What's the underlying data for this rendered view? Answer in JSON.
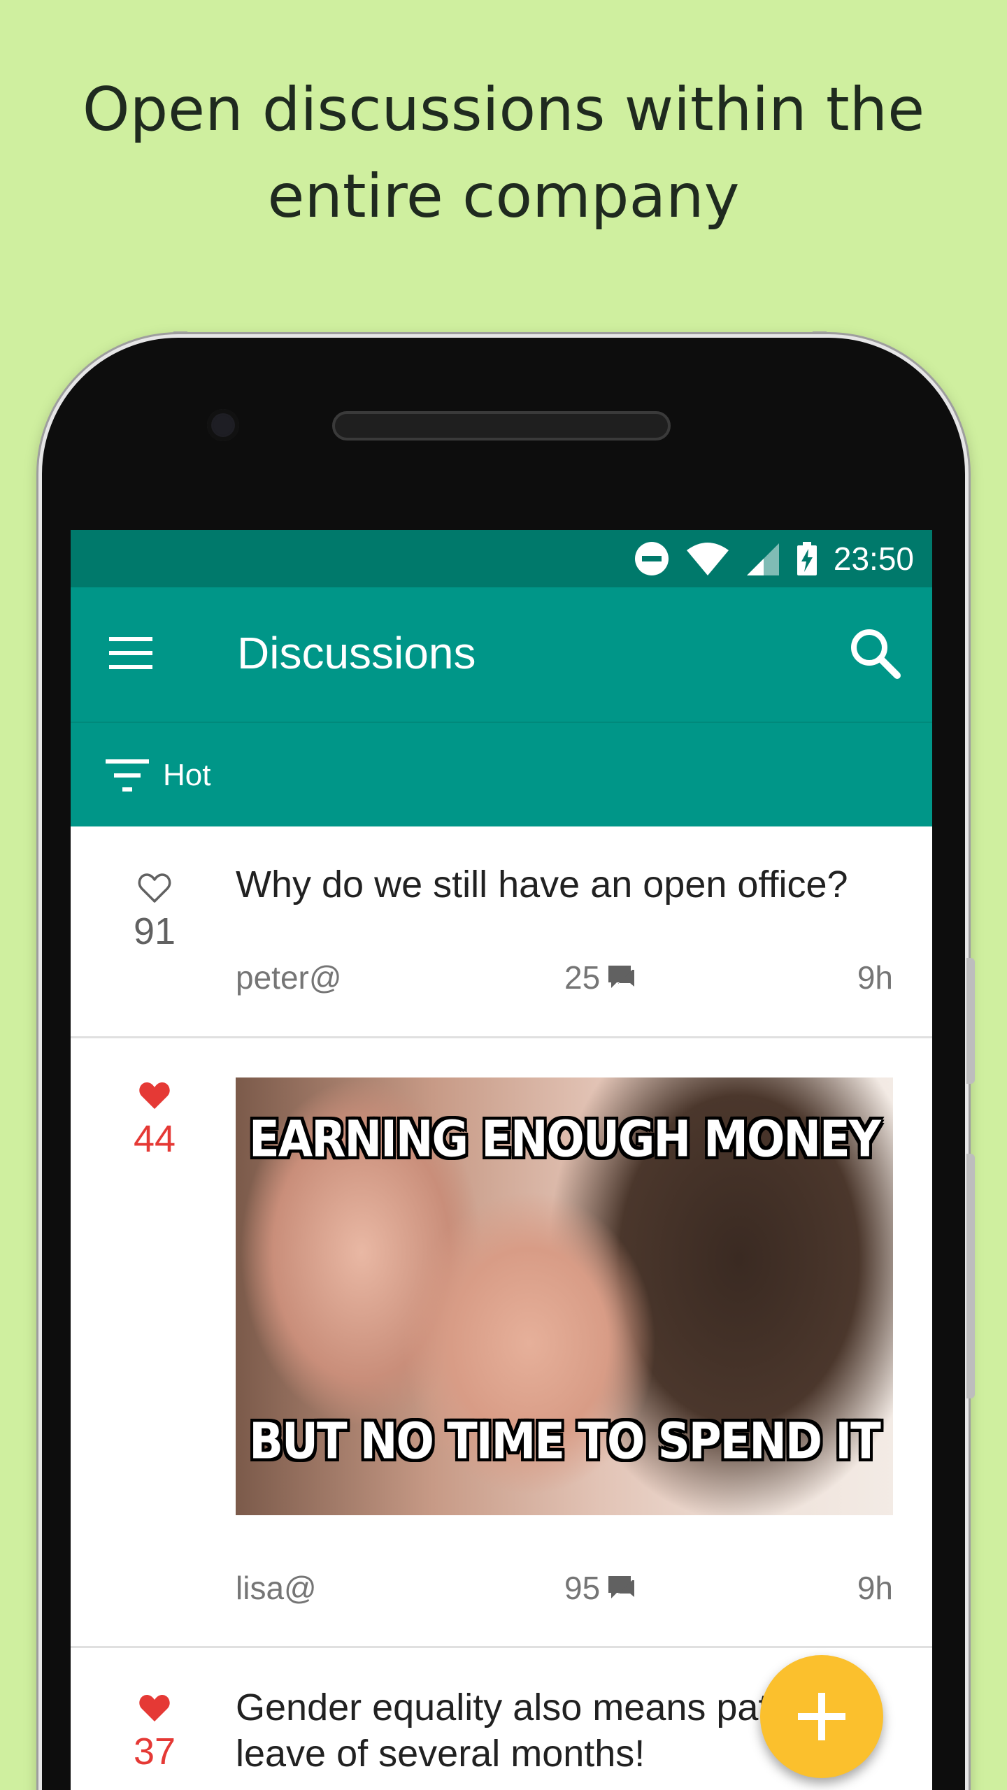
{
  "headline": {
    "line1": "Open discussions within the",
    "line2": "entire company"
  },
  "status_bar": {
    "time": "23:50",
    "icons": [
      "do-not-disturb-icon",
      "wifi-icon",
      "cell-signal-icon",
      "battery-charging-icon"
    ]
  },
  "app_bar": {
    "title": "Discussions",
    "menu_icon": "hamburger-menu-icon",
    "search_icon": "search-icon",
    "color": "#009688"
  },
  "filter": {
    "label": "Hot",
    "icon": "filter-list-icon"
  },
  "posts": [
    {
      "likes": "91",
      "liked": false,
      "title": "Why do we still have an open office?",
      "author": "peter@",
      "comments": "25",
      "age": "9h"
    },
    {
      "likes": "44",
      "liked": true,
      "image": {
        "top_text": "EARNING ENOUGH MONEY",
        "bottom_text": "BUT NO TIME TO SPEND IT"
      },
      "author": "lisa@",
      "comments": "95",
      "age": "9h"
    },
    {
      "likes": "37",
      "liked": true,
      "title_line1": "Gender equality also means pat",
      "title_line2": "leave of several months!"
    }
  ],
  "fab": {
    "icon": "plus-icon",
    "color": "#fbc02d"
  },
  "colors": {
    "background": "#cfef9f",
    "liked": "#e53935",
    "status_bar": "#00796b"
  }
}
